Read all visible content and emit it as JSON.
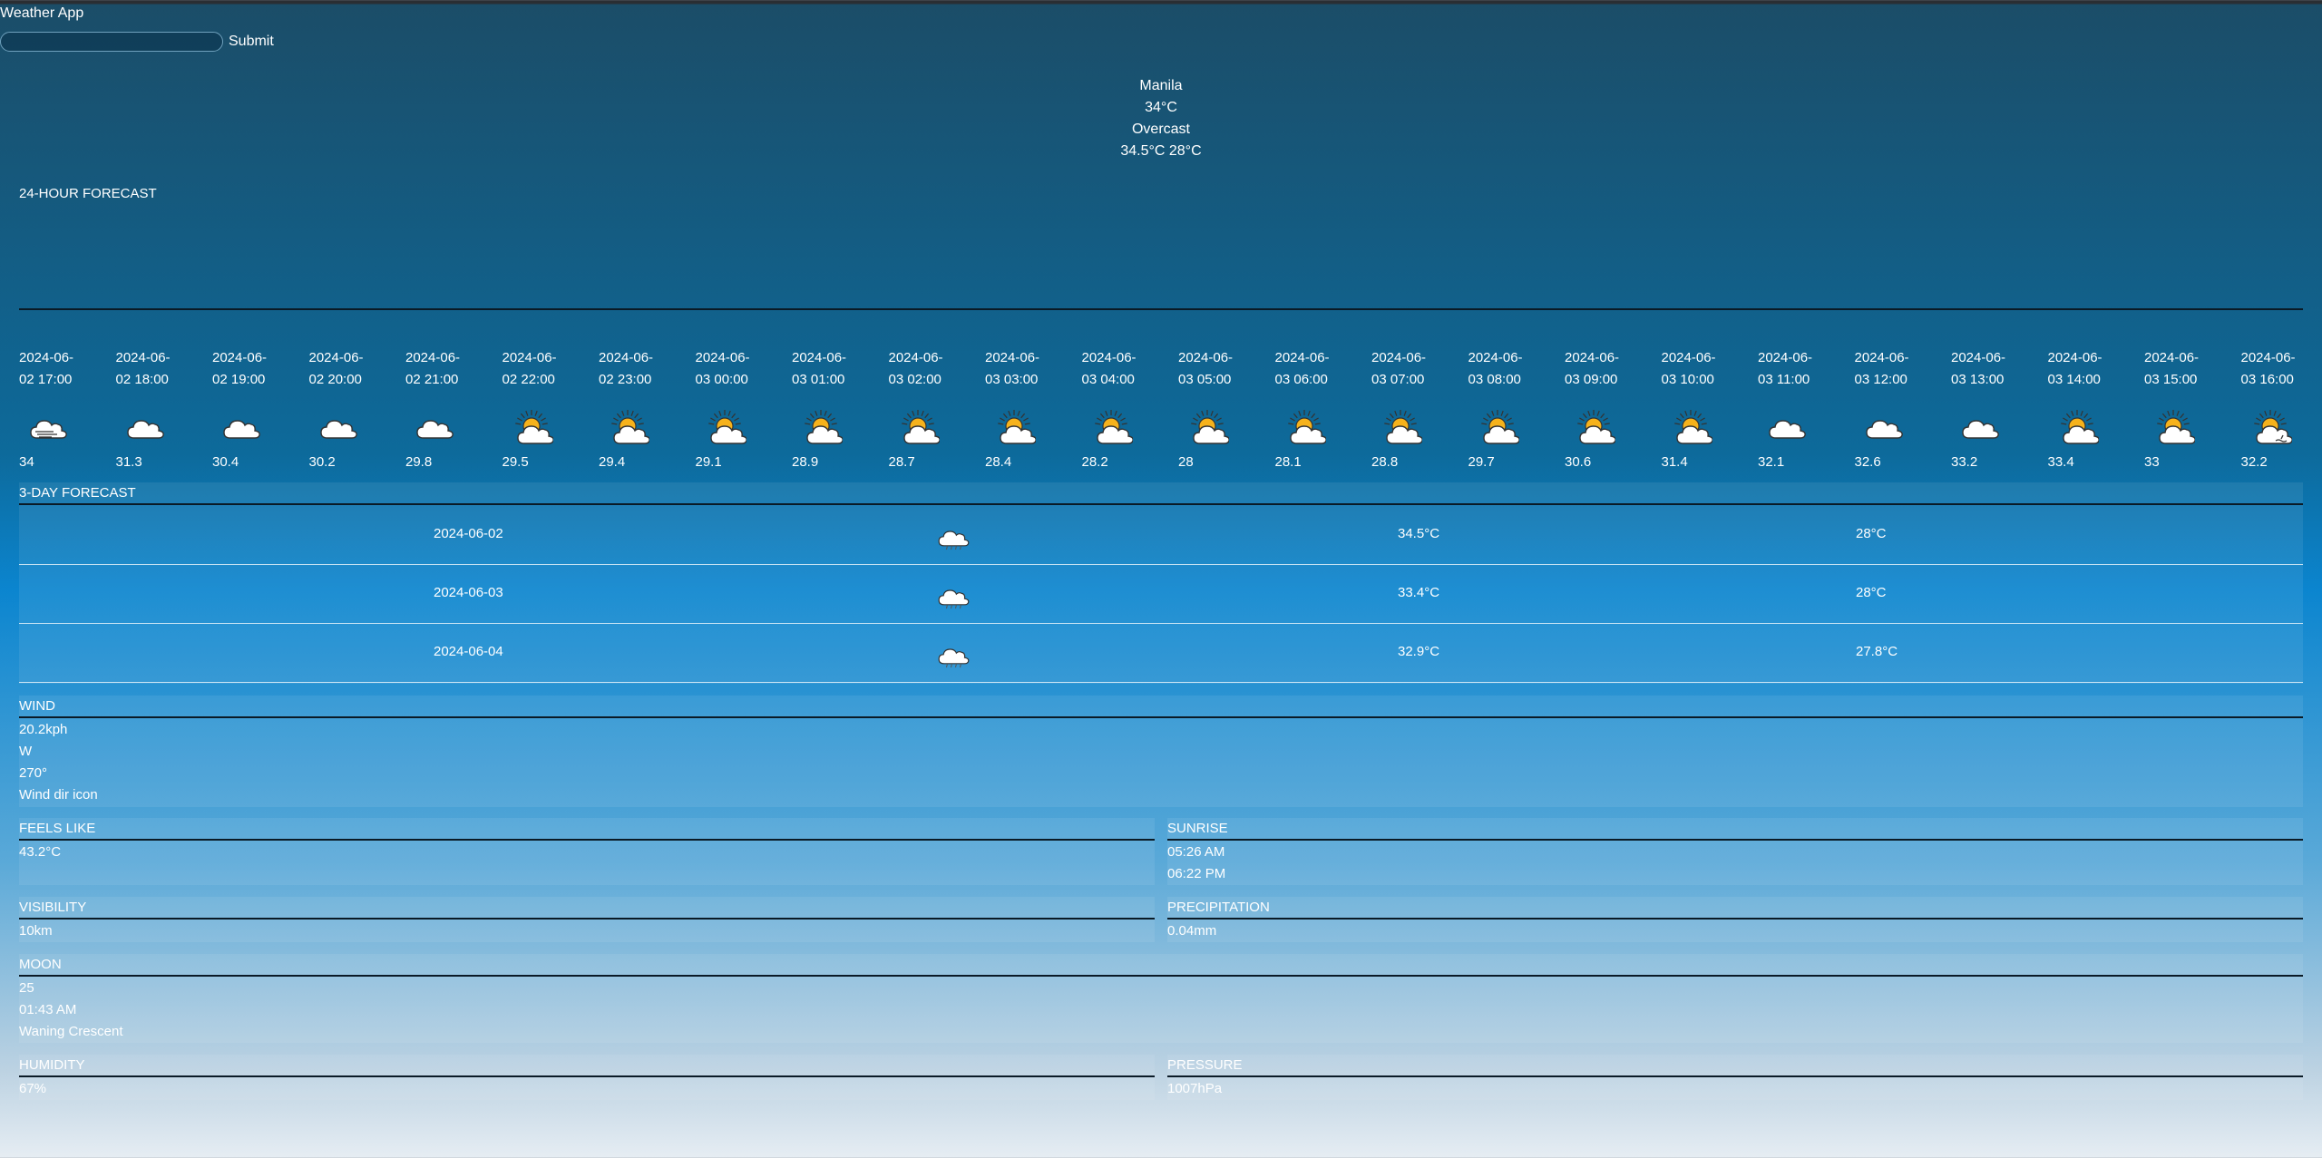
{
  "app_title": "Weather App",
  "search": {
    "placeholder": "",
    "value": "",
    "submit_label": "Submit"
  },
  "current": {
    "city": "Manila",
    "temp": "34°C",
    "condition": "Overcast",
    "high_low": "34.5°C 28°C"
  },
  "hourly": {
    "title": "24-HOUR FORECAST",
    "items": [
      {
        "date": "2024-06-",
        "time": "02 17:00",
        "temp": "34",
        "icon": "mist-icon"
      },
      {
        "date": "2024-06-",
        "time": "02 18:00",
        "temp": "31.3",
        "icon": "cloud-icon"
      },
      {
        "date": "2024-06-",
        "time": "02 19:00",
        "temp": "30.4",
        "icon": "cloud-icon"
      },
      {
        "date": "2024-06-",
        "time": "02 20:00",
        "temp": "30.2",
        "icon": "cloud-icon"
      },
      {
        "date": "2024-06-",
        "time": "02 21:00",
        "temp": "29.8",
        "icon": "cloud-icon"
      },
      {
        "date": "2024-06-",
        "time": "02 22:00",
        "temp": "29.5",
        "icon": "partly-cloudy-icon"
      },
      {
        "date": "2024-06-",
        "time": "02 23:00",
        "temp": "29.4",
        "icon": "partly-cloudy-icon"
      },
      {
        "date": "2024-06-",
        "time": "03 00:00",
        "temp": "29.1",
        "icon": "partly-cloudy-icon"
      },
      {
        "date": "2024-06-",
        "time": "03 01:00",
        "temp": "28.9",
        "icon": "partly-cloudy-icon"
      },
      {
        "date": "2024-06-",
        "time": "03 02:00",
        "temp": "28.7",
        "icon": "partly-cloudy-icon"
      },
      {
        "date": "2024-06-",
        "time": "03 03:00",
        "temp": "28.4",
        "icon": "partly-cloudy-icon"
      },
      {
        "date": "2024-06-",
        "time": "03 04:00",
        "temp": "28.2",
        "icon": "partly-cloudy-icon"
      },
      {
        "date": "2024-06-",
        "time": "03 05:00",
        "temp": "28",
        "icon": "partly-cloudy-icon"
      },
      {
        "date": "2024-06-",
        "time": "03 06:00",
        "temp": "28.1",
        "icon": "partly-cloudy-icon"
      },
      {
        "date": "2024-06-",
        "time": "03 07:00",
        "temp": "28.8",
        "icon": "partly-cloudy-icon"
      },
      {
        "date": "2024-06-",
        "time": "03 08:00",
        "temp": "29.7",
        "icon": "partly-cloudy-icon"
      },
      {
        "date": "2024-06-",
        "time": "03 09:00",
        "temp": "30.6",
        "icon": "partly-cloudy-icon"
      },
      {
        "date": "2024-06-",
        "time": "03 10:00",
        "temp": "31.4",
        "icon": "partly-cloudy-icon"
      },
      {
        "date": "2024-06-",
        "time": "03 11:00",
        "temp": "32.1",
        "icon": "cloud-icon"
      },
      {
        "date": "2024-06-",
        "time": "03 12:00",
        "temp": "32.6",
        "icon": "cloud-icon"
      },
      {
        "date": "2024-06-",
        "time": "03 13:00",
        "temp": "33.2",
        "icon": "cloud-icon"
      },
      {
        "date": "2024-06-",
        "time": "03 14:00",
        "temp": "33.4",
        "icon": "partly-cloudy-icon"
      },
      {
        "date": "2024-06-",
        "time": "03 15:00",
        "temp": "33",
        "icon": "partly-cloudy-icon"
      },
      {
        "date": "2024-06-",
        "time": "03 16:00",
        "temp": "32.2",
        "icon": "sun-rain-icon"
      }
    ]
  },
  "daily": {
    "title": "3-DAY FORECAST",
    "items": [
      {
        "date": "2024-06-02",
        "max": "34.5°C",
        "min": "28°C",
        "icon": "rain-cloud-icon"
      },
      {
        "date": "2024-06-03",
        "max": "33.4°C",
        "min": "28°C",
        "icon": "rain-cloud-icon"
      },
      {
        "date": "2024-06-04",
        "max": "32.9°C",
        "min": "27.8°C",
        "icon": "rain-cloud-icon"
      }
    ]
  },
  "wind": {
    "title": "WIND",
    "speed": "20.2kph",
    "dir": "W",
    "degree": "270°",
    "dir_icon_alt": "Wind dir icon"
  },
  "feels_like": {
    "title": "FEELS LIKE",
    "value": "43.2°C"
  },
  "sunrise": {
    "title": "SUNRISE",
    "sunrise": "05:26 AM",
    "sunset": "06:22 PM"
  },
  "visibility": {
    "title": "VISIBILITY",
    "value": "10km"
  },
  "precipitation": {
    "title": "PRECIPITATION",
    "value": "0.04mm"
  },
  "moon": {
    "title": "MOON",
    "illumination": "25",
    "moonrise": "01:43 AM",
    "phase": "Waning Crescent"
  },
  "humidity": {
    "title": "HUMIDITY",
    "value": "67%"
  },
  "pressure": {
    "title": "PRESSURE",
    "value": "1007hPa"
  },
  "colors": {
    "sun": "#f6b21b",
    "cloud_fill": "#ffffff",
    "outline": "#333333",
    "rule": "#0a1a26"
  }
}
